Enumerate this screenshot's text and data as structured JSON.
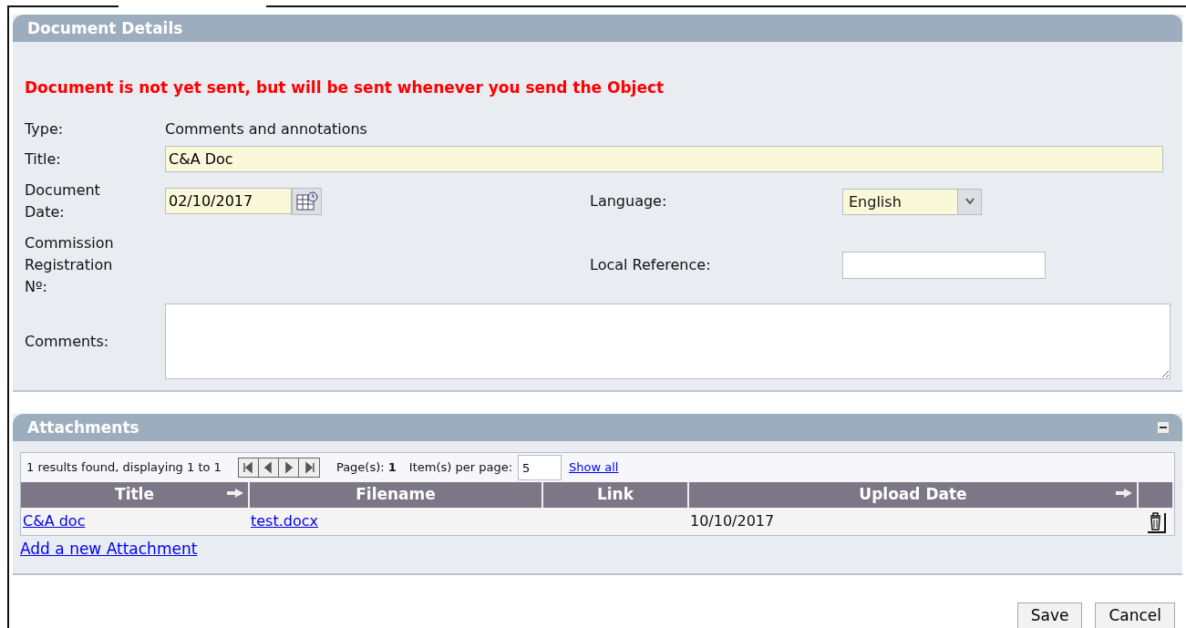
{
  "details": {
    "title": "Document Details",
    "warning": "Document is not yet sent, but will be sent whenever you send the Object",
    "type": {
      "label": "Type:",
      "value": "Comments and annotations"
    },
    "title_field": {
      "label": "Title:",
      "value": "C&A Doc"
    },
    "date_field": {
      "label": "Document Date:",
      "value": "02/10/2017"
    },
    "language": {
      "label": "Language:",
      "value": "English"
    },
    "commission": {
      "label": "Commission Registration Nº:"
    },
    "local_reference": {
      "label": "Local Reference:"
    },
    "comments": {
      "label": "Comments:"
    }
  },
  "attachments": {
    "title": "Attachments",
    "expanded": true,
    "pager": {
      "summary": "1 results found, displaying 1 to 1",
      "pages_label": "Page(s):",
      "pages": "1",
      "per_page_label": "Item(s) per page:",
      "per_page": "5",
      "show_all": "Show all"
    },
    "columns": [
      {
        "label": "Title",
        "sortable": true
      },
      {
        "label": "Filename",
        "sortable": false
      },
      {
        "label": "Link",
        "sortable": false
      },
      {
        "label": "Upload Date",
        "sortable": true
      },
      {
        "sortable": false
      }
    ],
    "rows": [
      {
        "title": "C&A doc",
        "filename": "test.docx",
        "upload_date": "10/10/2017"
      }
    ],
    "add_link": "Add a new Attachment"
  },
  "buttons": [
    "Save",
    "Cancel"
  ]
}
